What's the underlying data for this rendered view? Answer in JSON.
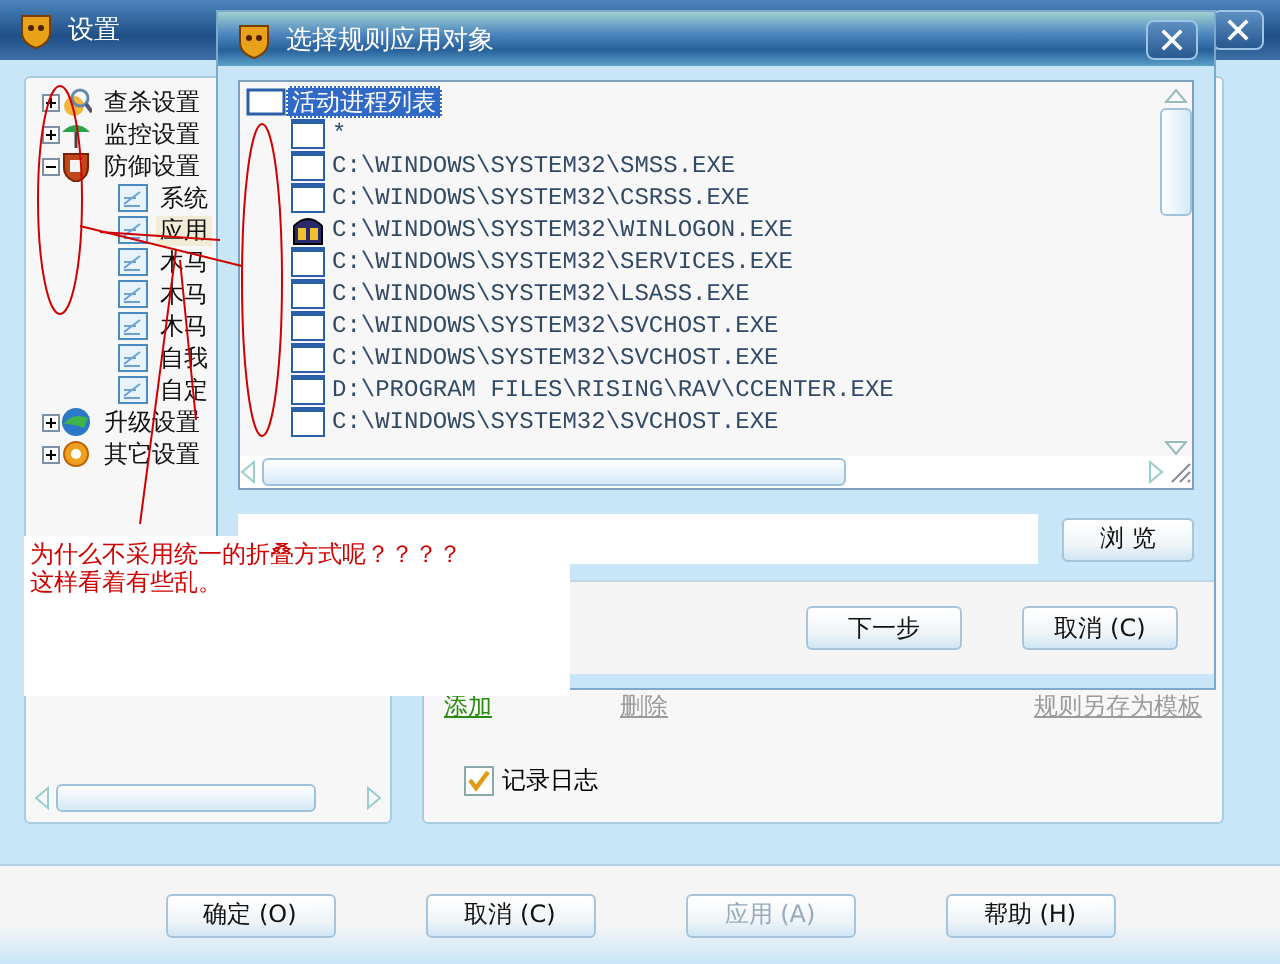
{
  "settings_window": {
    "title": "设置",
    "tree": [
      {
        "label": "查杀设置",
        "kind": "scan",
        "expanded": false
      },
      {
        "label": "监控设置",
        "kind": "monitor",
        "expanded": false
      },
      {
        "label": "防御设置",
        "kind": "defense",
        "expanded": true,
        "children": [
          {
            "label": "系统",
            "selected": false
          },
          {
            "label": "应用",
            "selected": true
          },
          {
            "label": "木马",
            "selected": false
          },
          {
            "label": "木马",
            "selected": false
          },
          {
            "label": "木马",
            "selected": false
          },
          {
            "label": "自我",
            "selected": false
          },
          {
            "label": "自定",
            "selected": false
          }
        ]
      },
      {
        "label": "升级设置",
        "kind": "upgrade",
        "expanded": false
      },
      {
        "label": "其它设置",
        "kind": "other",
        "expanded": false
      }
    ],
    "links": [
      {
        "label": "添加",
        "disabled": false
      },
      {
        "label": "删除",
        "disabled": true
      },
      {
        "label": "规则另存为模板",
        "disabled": true
      }
    ],
    "log_checkbox": {
      "label": "记录日志",
      "checked": true
    },
    "buttons": [
      {
        "label": "确定 (O)",
        "disabled": false
      },
      {
        "label": "取消 (C)",
        "disabled": false
      },
      {
        "label": "应用 (A)",
        "disabled": true
      },
      {
        "label": "帮助 (H)",
        "disabled": false
      }
    ]
  },
  "dialog": {
    "title": "选择规则应用对象",
    "process_tree": {
      "label": "活动进程列表",
      "selected": true,
      "children": [
        {
          "label": "*",
          "kind": "file"
        },
        {
          "label": "C:\\WINDOWS\\SYSTEM32\\SMSS.EXE",
          "kind": "file"
        },
        {
          "label": "C:\\WINDOWS\\SYSTEM32\\CSRSS.EXE",
          "kind": "file"
        },
        {
          "label": "C:\\WINDOWS\\SYSTEM32\\WINLOGON.EXE",
          "kind": "system"
        },
        {
          "label": "C:\\WINDOWS\\SYSTEM32\\SERVICES.EXE",
          "kind": "file"
        },
        {
          "label": "C:\\WINDOWS\\SYSTEM32\\LSASS.EXE",
          "kind": "file"
        },
        {
          "label": "C:\\WINDOWS\\SYSTEM32\\SVCHOST.EXE",
          "kind": "file"
        },
        {
          "label": "C:\\WINDOWS\\SYSTEM32\\SVCHOST.EXE",
          "kind": "file"
        },
        {
          "label": "D:\\PROGRAM FILES\\RISING\\RAV\\CCENTER.EXE",
          "kind": "file"
        },
        {
          "label": "C:\\WINDOWS\\SYSTEM32\\SVCHOST.EXE",
          "kind": "file"
        }
      ]
    },
    "browse_button": "浏 览",
    "buttons": [
      {
        "label": "下一步"
      },
      {
        "label": "取消 (C)"
      }
    ]
  },
  "annotation": {
    "lines": [
      "为什么不采用统一的折叠方式呢？？？？",
      "这样看着有些乱。"
    ]
  }
}
